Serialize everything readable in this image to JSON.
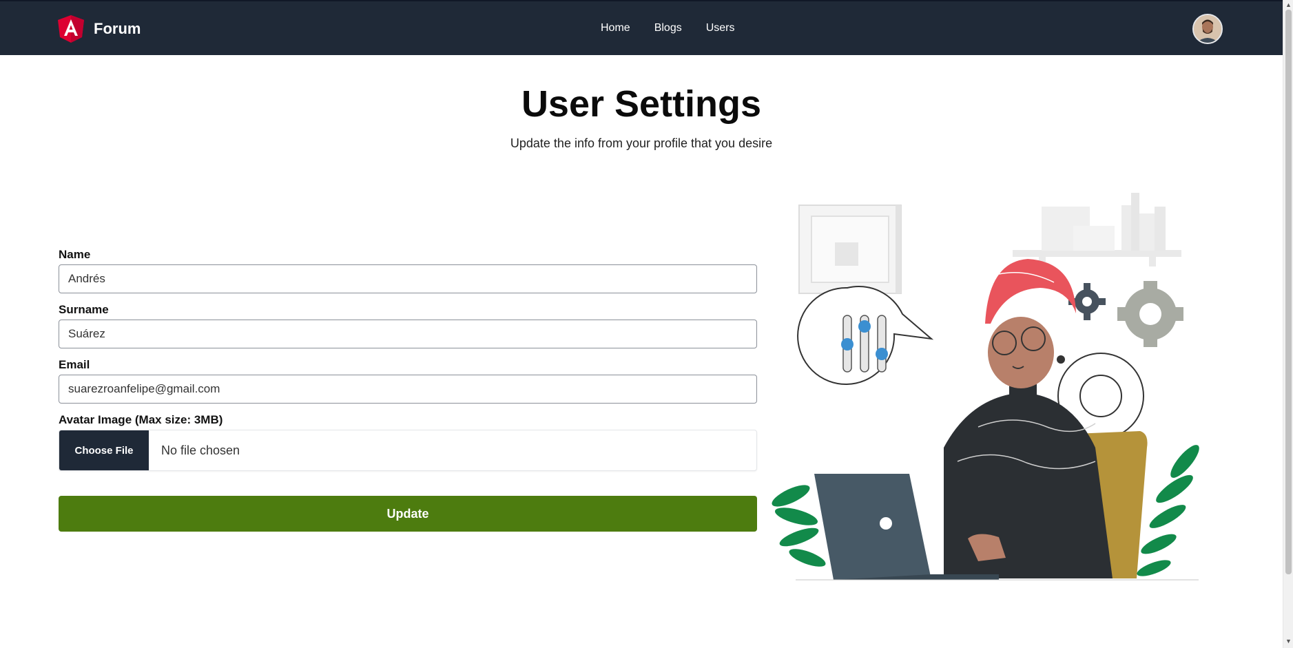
{
  "navbar": {
    "brand": "Forum",
    "logo_icon": "angular-logo-icon",
    "links": [
      "Home",
      "Blogs",
      "Users"
    ],
    "avatar_icon": "user-avatar"
  },
  "header": {
    "title": "User Settings",
    "subtitle": "Update the info from your profile that you desire"
  },
  "form": {
    "name_label": "Name",
    "name_value": "Andrés",
    "surname_label": "Surname",
    "surname_value": "Suárez",
    "email_label": "Email",
    "email_value": "suarezroanfelipe@gmail.com",
    "avatar_label": "Avatar Image (Max size: 3MB)",
    "file_button": "Choose File",
    "file_status": "No file chosen",
    "submit_label": "Update"
  },
  "colors": {
    "navbar": "#1f2937",
    "submit": "#4d7c0f",
    "brand_red": "#dd0031"
  }
}
